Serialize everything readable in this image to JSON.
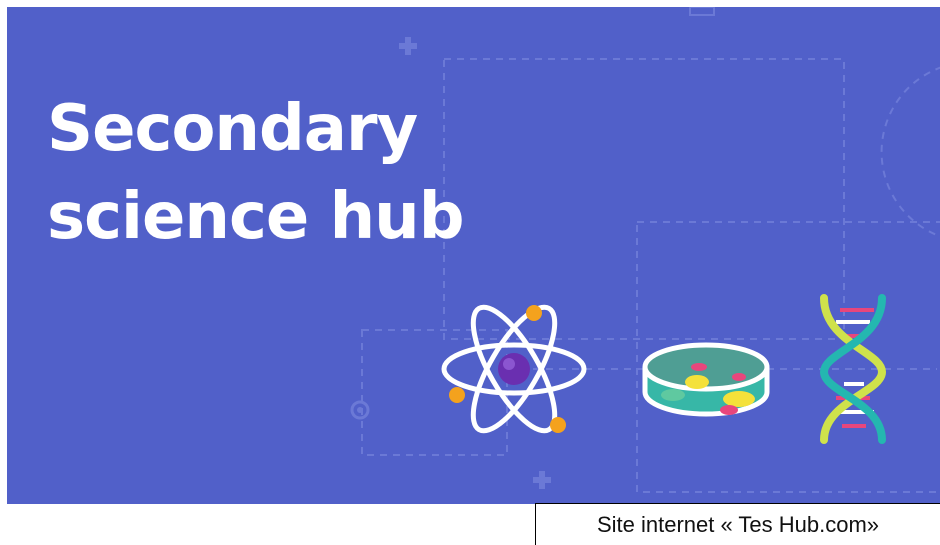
{
  "banner": {
    "title": "Secondary\nscience hub",
    "background_color": "#5160c9",
    "illustrations": [
      "atom-icon",
      "petri-dish-icon",
      "dna-helix-icon"
    ]
  },
  "caption": {
    "text": "Site internet « Tes Hub.com»"
  }
}
